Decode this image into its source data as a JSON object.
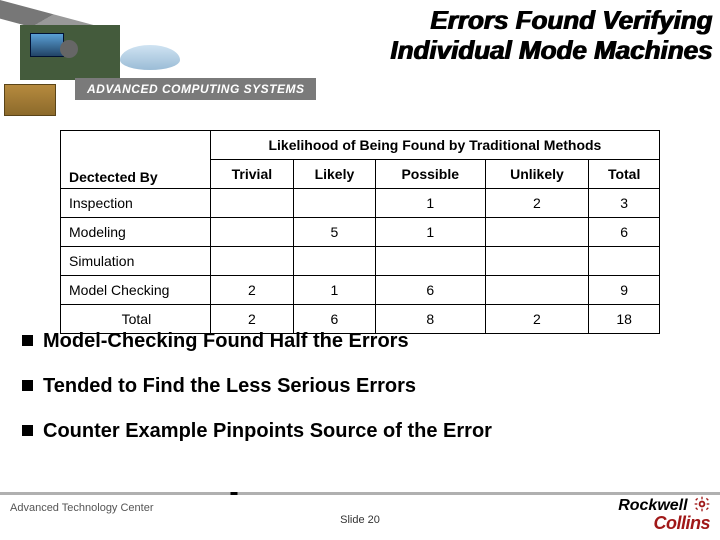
{
  "title_line1": "Errors Found Verifying",
  "title_line2": "Individual Mode Machines",
  "banner_label": "ADVANCED COMPUTING SYSTEMS",
  "table": {
    "spanner": "Likelihood of Being Found by Traditional Methods",
    "stub_head": "Dectected By",
    "cols": [
      "Trivial",
      "Likely",
      "Possible",
      "Unlikely",
      "Total"
    ],
    "rows": [
      {
        "label": "Inspection",
        "trivial": "",
        "likely": "",
        "possible": "1",
        "unlikely": "2",
        "total": "3"
      },
      {
        "label": "Modeling",
        "trivial": "",
        "likely": "5",
        "possible": "1",
        "unlikely": "",
        "total": "6"
      },
      {
        "label": "Simulation",
        "trivial": "",
        "likely": "",
        "possible": "",
        "unlikely": "",
        "total": ""
      },
      {
        "label": "Model Checking",
        "trivial": "2",
        "likely": "1",
        "possible": "6",
        "unlikely": "",
        "total": "9"
      }
    ],
    "total_row": {
      "label": "Total",
      "trivial": "2",
      "likely": "6",
      "possible": "8",
      "unlikely": "2",
      "total": "18"
    }
  },
  "bullets": [
    "Model-Checking Found Half the Errors",
    "Tended to Find the Less Serious Errors",
    "Counter Example Pinpoints Source of the Error"
  ],
  "footer": {
    "left": "Advanced Technology Center",
    "slide": "Slide 20",
    "logo_top": "Rockwell",
    "logo_bottom": "Collins"
  },
  "chart_data": {
    "type": "table",
    "title": "Errors Found Verifying Individual Mode Machines",
    "column_spanner": "Likelihood of Being Found by Traditional Methods",
    "row_header": "Dectected By",
    "columns": [
      "Trivial",
      "Likely",
      "Possible",
      "Unlikely",
      "Total"
    ],
    "rows": [
      {
        "label": "Inspection",
        "values": [
          null,
          null,
          1,
          2,
          3
        ]
      },
      {
        "label": "Modeling",
        "values": [
          null,
          5,
          1,
          null,
          6
        ]
      },
      {
        "label": "Simulation",
        "values": [
          null,
          null,
          null,
          null,
          null
        ]
      },
      {
        "label": "Model Checking",
        "values": [
          2,
          1,
          6,
          null,
          9
        ]
      },
      {
        "label": "Total",
        "values": [
          2,
          6,
          8,
          2,
          18
        ]
      }
    ]
  }
}
